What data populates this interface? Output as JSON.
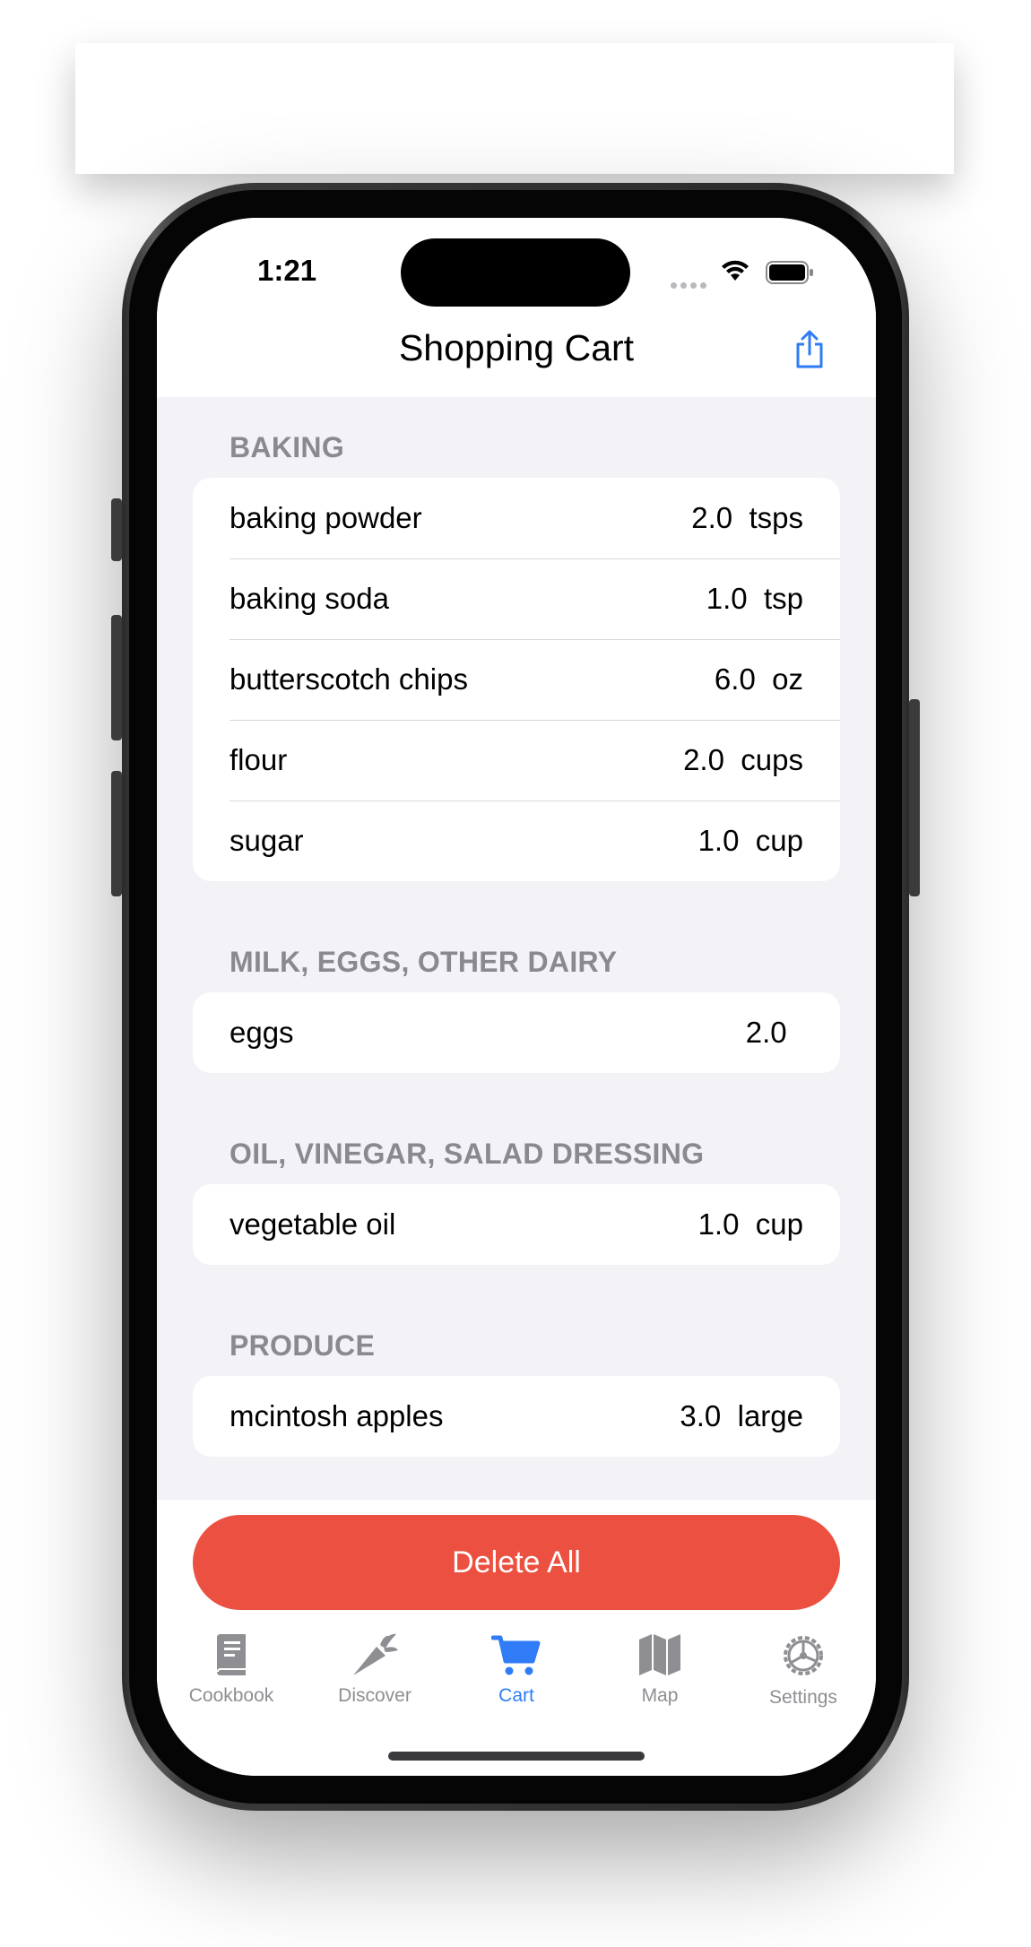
{
  "status_bar": {
    "time": "1:21"
  },
  "nav": {
    "title": "Shopping Cart"
  },
  "sections": [
    {
      "header": "BAKING",
      "items": [
        {
          "name": "baking powder",
          "qty": "2.0  tsps"
        },
        {
          "name": "baking soda",
          "qty": "1.0  tsp"
        },
        {
          "name": "butterscotch chips",
          "qty": "6.0  oz"
        },
        {
          "name": "flour",
          "qty": "2.0  cups"
        },
        {
          "name": "sugar",
          "qty": "1.0  cup"
        }
      ]
    },
    {
      "header": "MILK, EGGS, OTHER DAIRY",
      "items": [
        {
          "name": "eggs",
          "qty": "2.0  "
        }
      ]
    },
    {
      "header": "OIL, VINEGAR, SALAD DRESSING",
      "items": [
        {
          "name": "vegetable oil",
          "qty": "1.0  cup"
        }
      ]
    },
    {
      "header": "PRODUCE",
      "items": [
        {
          "name": "mcintosh apples",
          "qty": "3.0  large"
        }
      ]
    }
  ],
  "actions": {
    "delete_all": "Delete All"
  },
  "tabs": [
    {
      "label": "Cookbook",
      "icon": "book-icon"
    },
    {
      "label": "Discover",
      "icon": "carrot-icon"
    },
    {
      "label": "Cart",
      "icon": "cart-icon",
      "active": true
    },
    {
      "label": "Map",
      "icon": "map-icon"
    },
    {
      "label": "Settings",
      "icon": "gear-icon"
    }
  ],
  "colors": {
    "accent": "#2f7cf6",
    "destructive": "#eb5040",
    "section_header": "#8a8a8e"
  }
}
